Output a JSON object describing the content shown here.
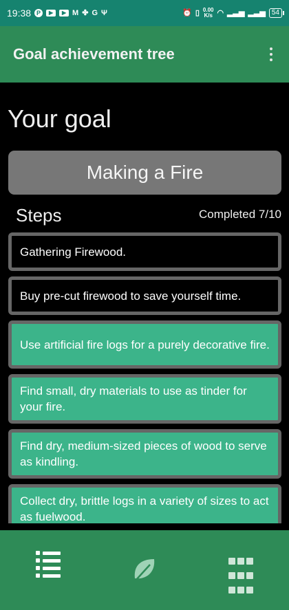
{
  "status_bar": {
    "time": "19:38",
    "speed_top": "0.00",
    "speed_bottom": "K/s",
    "battery": "54"
  },
  "app_bar": {
    "title": "Goal achievement tree",
    "menu_icon": "more-vert-icon"
  },
  "goal": {
    "heading": "Your goal",
    "name": "Making a Fire"
  },
  "steps": {
    "label": "Steps",
    "completed": "Completed 7/10",
    "items": [
      {
        "text": "Gathering Firewood.",
        "done": false
      },
      {
        "text": "Buy pre-cut firewood to save yourself time.",
        "done": false
      },
      {
        "text": "Use artificial fire logs for a purely decorative fire.",
        "done": true
      },
      {
        "text": "Find small, dry materials to use as tinder for your fire.",
        "done": true
      },
      {
        "text": "Find dry, medium-sized pieces of wood to serve as kindling.",
        "done": true
      },
      {
        "text": "Collect dry, brittle logs in a variety of sizes to act as fuelwood.",
        "done": true
      }
    ]
  },
  "bottom_nav": {
    "items": [
      {
        "icon": "list-icon"
      },
      {
        "icon": "leaf-icon"
      },
      {
        "icon": "grid-icon"
      }
    ]
  },
  "colors": {
    "status_bar": "#16836f",
    "app_bar": "#2e8b57",
    "step_done": "#3cb48a",
    "step_pending": "#000000",
    "goal_box": "#777777"
  }
}
